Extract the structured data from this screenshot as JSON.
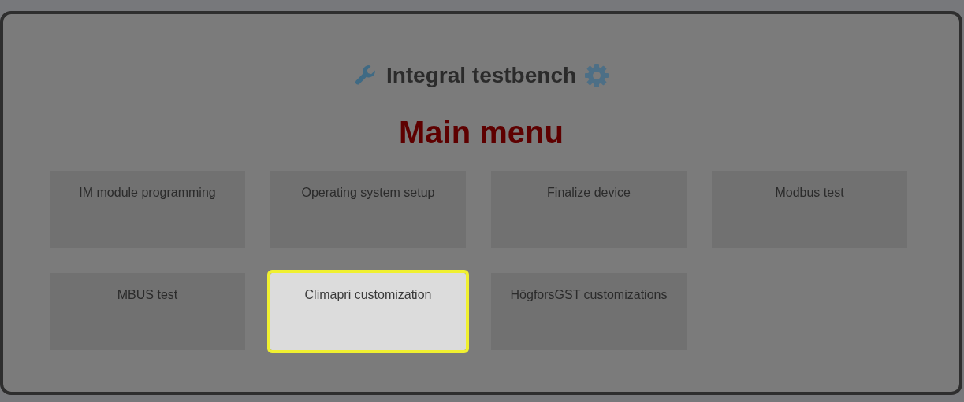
{
  "header": {
    "title": "Integral testbench"
  },
  "heading": "Main menu",
  "menu_items": [
    {
      "label": "IM module programming",
      "selected": false
    },
    {
      "label": "Operating system setup",
      "selected": false
    },
    {
      "label": "Finalize device",
      "selected": false
    },
    {
      "label": "Modbus test",
      "selected": false
    },
    {
      "label": "MBUS test",
      "selected": false
    },
    {
      "label": "Climapri customization",
      "selected": true
    },
    {
      "label": "HögforsGST customizations",
      "selected": false
    }
  ]
}
